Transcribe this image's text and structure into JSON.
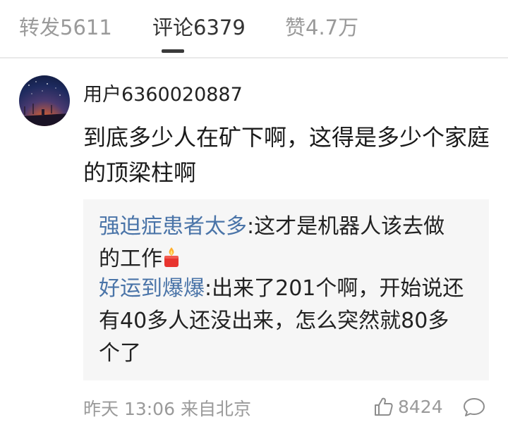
{
  "tabs": [
    {
      "label": "转发5611"
    },
    {
      "label": "评论6379"
    },
    {
      "label": "赞4.7万"
    }
  ],
  "comment": {
    "username": "用户6360020887",
    "text": "到底多少人在矿下啊，这得是多少个家庭的顶梁柱啊",
    "replies": [
      {
        "name": "强迫症患者太多",
        "sep": ":",
        "text": "这才是机器人该去做的工作",
        "emoji": "candle"
      },
      {
        "name": "好运到爆爆",
        "sep": ":",
        "text": "出来了201个啊，开始说还有40多人还没出来，怎么突然就80多个了"
      }
    ],
    "meta": "昨天 13:06 来自北京",
    "likes": "8424"
  }
}
